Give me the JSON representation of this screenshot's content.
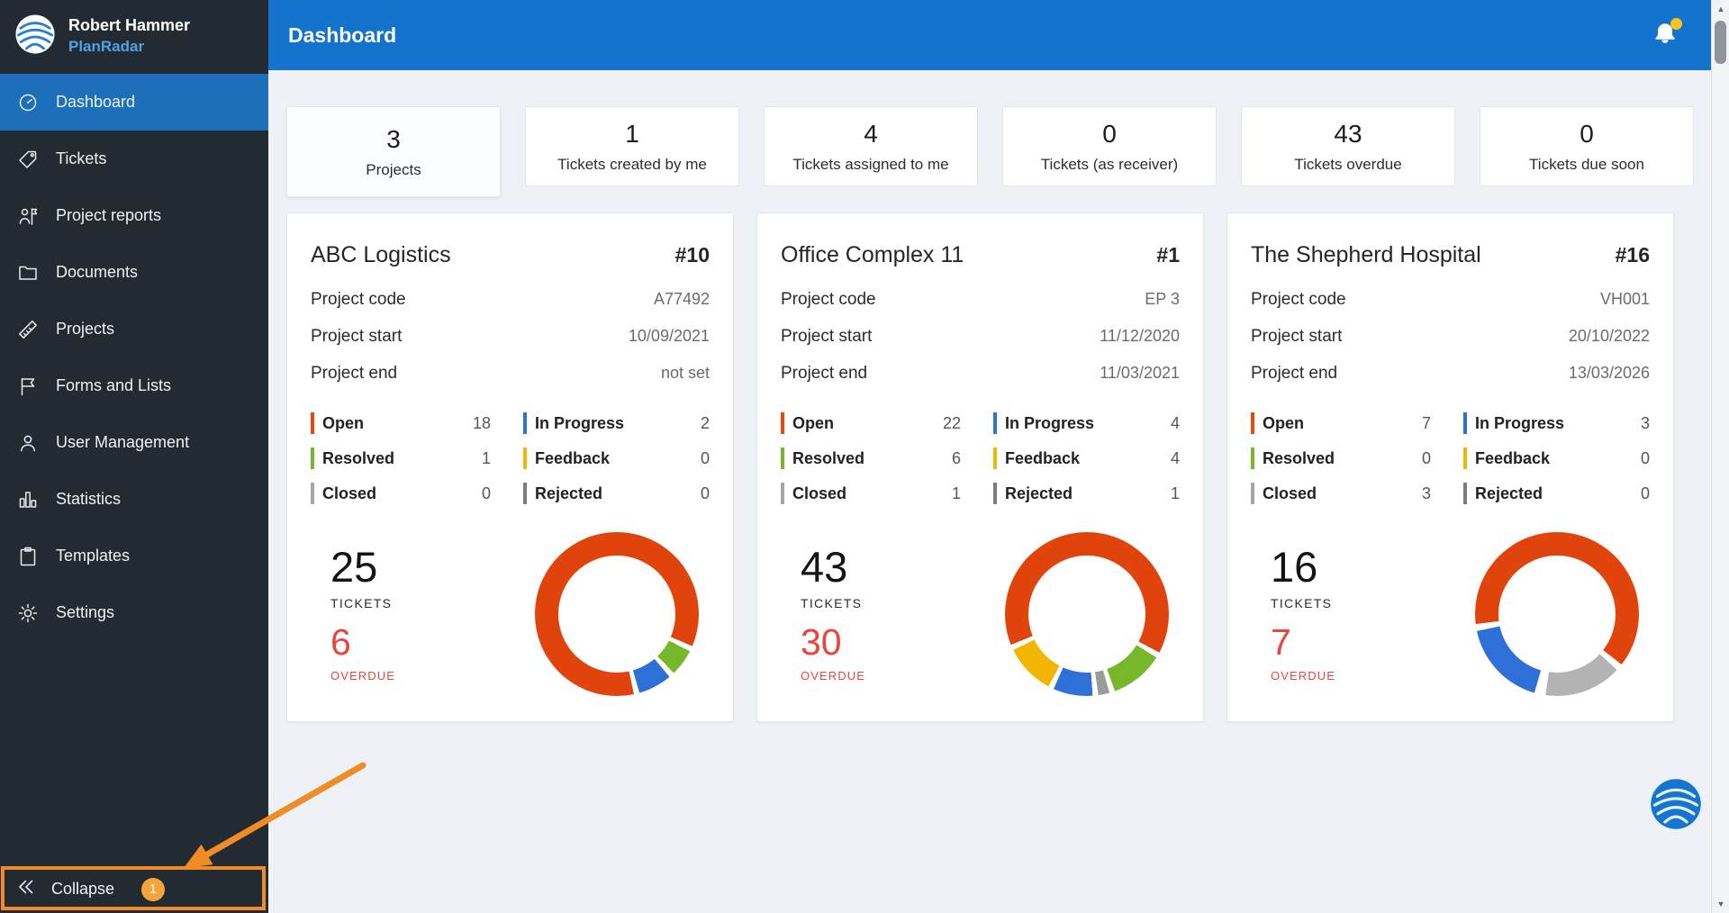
{
  "sidebar": {
    "user_name": "Robert Hammer",
    "brand_name": "PlanRadar",
    "items": [
      {
        "label": "Dashboard",
        "icon": "dashboard-gauge-icon",
        "active": true
      },
      {
        "label": "Tickets",
        "icon": "ticket-tag-icon",
        "active": false
      },
      {
        "label": "Project reports",
        "icon": "project-reports-person-flag-icon",
        "active": false
      },
      {
        "label": "Documents",
        "icon": "documents-folder-icon",
        "active": false
      },
      {
        "label": "Projects",
        "icon": "projects-ruler-icon",
        "active": false
      },
      {
        "label": "Forms and Lists",
        "icon": "forms-flag-icon",
        "active": false
      },
      {
        "label": "User Management",
        "icon": "user-icon",
        "active": false
      },
      {
        "label": "Statistics",
        "icon": "statistics-bars-icon",
        "active": false
      },
      {
        "label": "Templates",
        "icon": "templates-clipboard-icon",
        "active": false
      },
      {
        "label": "Settings",
        "icon": "settings-gear-icon",
        "active": false
      }
    ],
    "collapse": {
      "label": "Collapse",
      "badge": "1"
    }
  },
  "header": {
    "title": "Dashboard"
  },
  "stat_tabs": [
    {
      "value": "3",
      "label": "Projects",
      "active": true
    },
    {
      "value": "1",
      "label": "Tickets created by me",
      "active": false
    },
    {
      "value": "4",
      "label": "Tickets assigned to me",
      "active": false
    },
    {
      "value": "0",
      "label": "Tickets (as receiver)",
      "active": false
    },
    {
      "value": "43",
      "label": "Tickets overdue",
      "active": false
    },
    {
      "value": "0",
      "label": "Tickets due soon",
      "active": false
    }
  ],
  "labels": {
    "project_code": "Project code",
    "project_start": "Project start",
    "project_end": "Project end",
    "tickets": "TICKETS",
    "overdue": "OVERDUE"
  },
  "projects": [
    {
      "name": "ABC Logistics",
      "number": "#10",
      "code": "A77492",
      "start": "10/09/2021",
      "end": "not set",
      "tickets_total": "25",
      "overdue": "6",
      "statuses": [
        {
          "label": "Open",
          "count": "18",
          "color": "#e8490f"
        },
        {
          "label": "In Progress",
          "count": "2",
          "color": "#2e6fd8"
        },
        {
          "label": "Resolved",
          "count": "1",
          "color": "#76b82a"
        },
        {
          "label": "Feedback",
          "count": "0",
          "color": "#f2b600"
        },
        {
          "label": "Closed",
          "count": "0",
          "color": "#a6a6a6"
        },
        {
          "label": "Rejected",
          "count": "0",
          "color": "#7d7d7d"
        }
      ],
      "donut": {
        "segments": [
          {
            "color": "#e0440c",
            "deg": 113
          },
          {
            "color": "#ffffff",
            "deg": 4
          },
          {
            "color": "#76b82a",
            "deg": 19
          },
          {
            "color": "#ffffff",
            "deg": 4
          },
          {
            "color": "#2e6fd8",
            "deg": 24
          },
          {
            "color": "#ffffff",
            "deg": 4
          },
          {
            "color": "#e0440c",
            "deg": 192
          }
        ]
      }
    },
    {
      "name": "Office Complex 11",
      "number": "#1",
      "code": "EP 3",
      "start": "11/12/2020",
      "end": "11/03/2021",
      "tickets_total": "43",
      "overdue": "30",
      "statuses": [
        {
          "label": "Open",
          "count": "22",
          "color": "#e8490f"
        },
        {
          "label": "In Progress",
          "count": "4",
          "color": "#2e6fd8"
        },
        {
          "label": "Resolved",
          "count": "6",
          "color": "#76b82a"
        },
        {
          "label": "Feedback",
          "count": "4",
          "color": "#f2b600"
        },
        {
          "label": "Closed",
          "count": "1",
          "color": "#a6a6a6"
        },
        {
          "label": "Rejected",
          "count": "1",
          "color": "#7d7d7d"
        }
      ],
      "donut": {
        "segments": [
          {
            "color": "#e0440c",
            "deg": 118
          },
          {
            "color": "#ffffff",
            "deg": 4
          },
          {
            "color": "#76b82a",
            "deg": 38
          },
          {
            "color": "#ffffff",
            "deg": 4
          },
          {
            "color": "#9b9b9b",
            "deg": 8
          },
          {
            "color": "#ffffff",
            "deg": 4
          },
          {
            "color": "#2e6fd8",
            "deg": 28
          },
          {
            "color": "#ffffff",
            "deg": 4
          },
          {
            "color": "#f2b600",
            "deg": 36
          },
          {
            "color": "#ffffff",
            "deg": 4
          },
          {
            "color": "#e0440c",
            "deg": 112
          }
        ]
      }
    },
    {
      "name": "The Shepherd Hospital",
      "number": "#16",
      "code": "VH001",
      "start": "20/10/2022",
      "end": "13/03/2026",
      "tickets_total": "16",
      "overdue": "7",
      "statuses": [
        {
          "label": "Open",
          "count": "7",
          "color": "#e8490f"
        },
        {
          "label": "In Progress",
          "count": "3",
          "color": "#2e6fd8"
        },
        {
          "label": "Resolved",
          "count": "0",
          "color": "#76b82a"
        },
        {
          "label": "Feedback",
          "count": "0",
          "color": "#f2b600"
        },
        {
          "label": "Closed",
          "count": "3",
          "color": "#a6a6a6"
        },
        {
          "label": "Rejected",
          "count": "0",
          "color": "#7d7d7d"
        }
      ],
      "donut": {
        "segments": [
          {
            "color": "#e0440c",
            "deg": 128
          },
          {
            "color": "#ffffff",
            "deg": 5
          },
          {
            "color": "#b3b3b3",
            "deg": 55
          },
          {
            "color": "#ffffff",
            "deg": 8
          },
          {
            "color": "#2e6fd8",
            "deg": 62
          },
          {
            "color": "#ffffff",
            "deg": 5
          },
          {
            "color": "#e0440c",
            "deg": 97
          }
        ]
      }
    }
  ],
  "colors": {
    "header_blue": "#1473cd",
    "sidebar_bg": "#212b31",
    "active_menu_blue": "#1d6fba",
    "content_bg": "#eef1f5",
    "overdue_red": "#e8463c",
    "annotation_orange": "#f08b25",
    "brand_blue": "#4ea3e6",
    "badge_orange": "#f5a33b",
    "notification_dot_yellow": "#f6c51e"
  }
}
